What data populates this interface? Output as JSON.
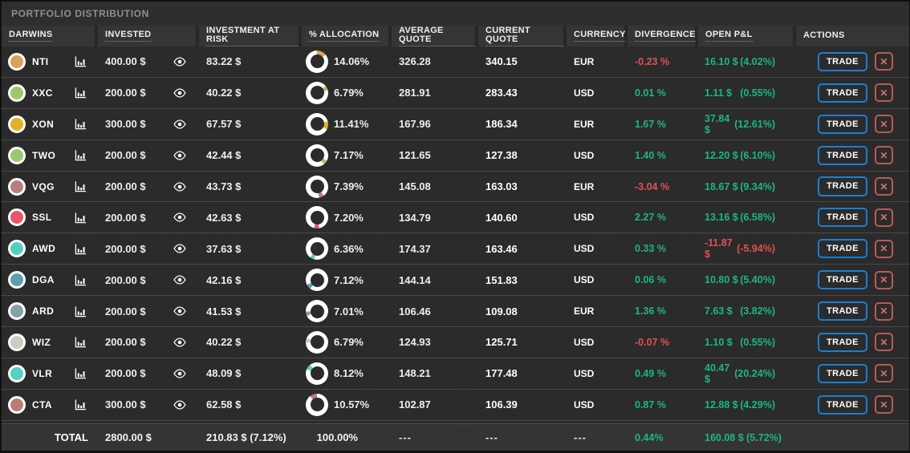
{
  "panel": {
    "title": "PORTFOLIO DISTRIBUTION"
  },
  "colors": {
    "positive": "#1db586",
    "negative": "#e0524f",
    "trade_border": "#1b7fd4",
    "close_border": "#ba5a56"
  },
  "table": {
    "columns": [
      "DARWINS",
      "INVESTED",
      "INVESTMENT AT RISK",
      "% ALLOCATION",
      "AVERAGE QUOTE",
      "CURRENT QUOTE",
      "CURRENCY",
      "DIVERGENCE",
      "OPEN P&L",
      "ACTIONS"
    ],
    "rows": [
      {
        "name": "NTI",
        "color": "#d9a256",
        "invested": "400.00 $",
        "risk": "83.22 $",
        "allocation": 14.06,
        "allocation_label": "14.06%",
        "avg_quote": "326.28",
        "current_quote": "340.15",
        "currency": "EUR",
        "divergence": "-0.23 %",
        "divergence_state": "negative",
        "pnl": "16.10 $",
        "pnl_pct": "(4.02%)",
        "pnl_state": "positive"
      },
      {
        "name": "XXC",
        "color": "#9dc76b",
        "invested": "200.00 $",
        "risk": "40.22 $",
        "allocation": 6.79,
        "allocation_label": "6.79%",
        "avg_quote": "281.91",
        "current_quote": "283.43",
        "currency": "USD",
        "divergence": "0.01 %",
        "divergence_state": "positive",
        "pnl": "1.11 $",
        "pnl_pct": "(0.55%)",
        "pnl_state": "positive"
      },
      {
        "name": "XON",
        "color": "#e0b322",
        "invested": "300.00 $",
        "risk": "67.57 $",
        "allocation": 11.41,
        "allocation_label": "11.41%",
        "avg_quote": "167.96",
        "current_quote": "186.34",
        "currency": "EUR",
        "divergence": "1.67 %",
        "divergence_state": "positive",
        "pnl": "37.84 $",
        "pnl_pct": "(12.61%)",
        "pnl_state": "positive"
      },
      {
        "name": "TWO",
        "color": "#9cc873",
        "invested": "200.00 $",
        "risk": "42.44 $",
        "allocation": 7.17,
        "allocation_label": "7.17%",
        "avg_quote": "121.65",
        "current_quote": "127.38",
        "currency": "USD",
        "divergence": "1.40 %",
        "divergence_state": "positive",
        "pnl": "12.20 $",
        "pnl_pct": "(6.10%)",
        "pnl_state": "positive"
      },
      {
        "name": "VQG",
        "color": "#b97f80",
        "invested": "200.00 $",
        "risk": "43.73 $",
        "allocation": 7.39,
        "allocation_label": "7.39%",
        "avg_quote": "145.08",
        "current_quote": "163.03",
        "currency": "EUR",
        "divergence": "-3.04 %",
        "divergence_state": "negative",
        "pnl": "18.67 $",
        "pnl_pct": "(9.34%)",
        "pnl_state": "positive"
      },
      {
        "name": "SSL",
        "color": "#e8566e",
        "invested": "200.00 $",
        "risk": "42.63 $",
        "allocation": 7.2,
        "allocation_label": "7.20%",
        "avg_quote": "134.79",
        "current_quote": "140.60",
        "currency": "USD",
        "divergence": "2.27 %",
        "divergence_state": "positive",
        "pnl": "13.16 $",
        "pnl_pct": "(6.58%)",
        "pnl_state": "positive"
      },
      {
        "name": "AWD",
        "color": "#53cfc0",
        "invested": "200.00 $",
        "risk": "37.63 $",
        "allocation": 6.36,
        "allocation_label": "6.36%",
        "avg_quote": "174.37",
        "current_quote": "163.46",
        "currency": "USD",
        "divergence": "0.33 %",
        "divergence_state": "positive",
        "pnl": "-11.87 $",
        "pnl_pct": "(-5.94%)",
        "pnl_state": "negative"
      },
      {
        "name": "DGA",
        "color": "#5f9fae",
        "invested": "200.00 $",
        "risk": "42.16 $",
        "allocation": 7.12,
        "allocation_label": "7.12%",
        "avg_quote": "144.14",
        "current_quote": "151.83",
        "currency": "USD",
        "divergence": "0.06 %",
        "divergence_state": "positive",
        "pnl": "10.80 $",
        "pnl_pct": "(5.40%)",
        "pnl_state": "positive"
      },
      {
        "name": "ARD",
        "color": "#84a3a8",
        "invested": "200.00 $",
        "risk": "41.53 $",
        "allocation": 7.01,
        "allocation_label": "7.01%",
        "avg_quote": "106.46",
        "current_quote": "109.08",
        "currency": "EUR",
        "divergence": "1.36 %",
        "divergence_state": "positive",
        "pnl": "7.63 $",
        "pnl_pct": "(3.82%)",
        "pnl_state": "positive"
      },
      {
        "name": "WIZ",
        "color": "#c6cfc1",
        "invested": "200.00 $",
        "risk": "40.22 $",
        "allocation": 6.79,
        "allocation_label": "6.79%",
        "avg_quote": "124.93",
        "current_quote": "125.71",
        "currency": "USD",
        "divergence": "-0.07 %",
        "divergence_state": "negative",
        "pnl": "1.10 $",
        "pnl_pct": "(0.55%)",
        "pnl_state": "positive"
      },
      {
        "name": "VLR",
        "color": "#54d0c4",
        "invested": "200.00 $",
        "risk": "48.09 $",
        "allocation": 8.12,
        "allocation_label": "8.12%",
        "avg_quote": "148.21",
        "current_quote": "177.48",
        "currency": "USD",
        "divergence": "0.49 %",
        "divergence_state": "positive",
        "pnl": "40.47 $",
        "pnl_pct": "(20.24%)",
        "pnl_state": "positive"
      },
      {
        "name": "CTA",
        "color": "#bb7a77",
        "invested": "300.00 $",
        "risk": "62.58 $",
        "allocation": 10.57,
        "allocation_label": "10.57%",
        "avg_quote": "102.87",
        "current_quote": "106.39",
        "currency": "USD",
        "divergence": "0.87 %",
        "divergence_state": "positive",
        "pnl": "12.88 $",
        "pnl_pct": "(4.29%)",
        "pnl_state": "positive"
      }
    ],
    "total": {
      "label": "TOTAL",
      "invested": "2800.00 $",
      "risk": "210.83 $ (7.12%)",
      "allocation": "100.00%",
      "avg_quote": "---",
      "current_quote": "---",
      "currency": "---",
      "divergence": "0.44%",
      "divergence_state": "positive",
      "pnl": "160.08 $ (5.72%)",
      "pnl_state": "positive"
    }
  },
  "actions": {
    "trade_label": "TRADE",
    "close_icon": "✕"
  },
  "icons": {
    "chart": "bar-chart-icon",
    "eye": "eye-icon"
  }
}
